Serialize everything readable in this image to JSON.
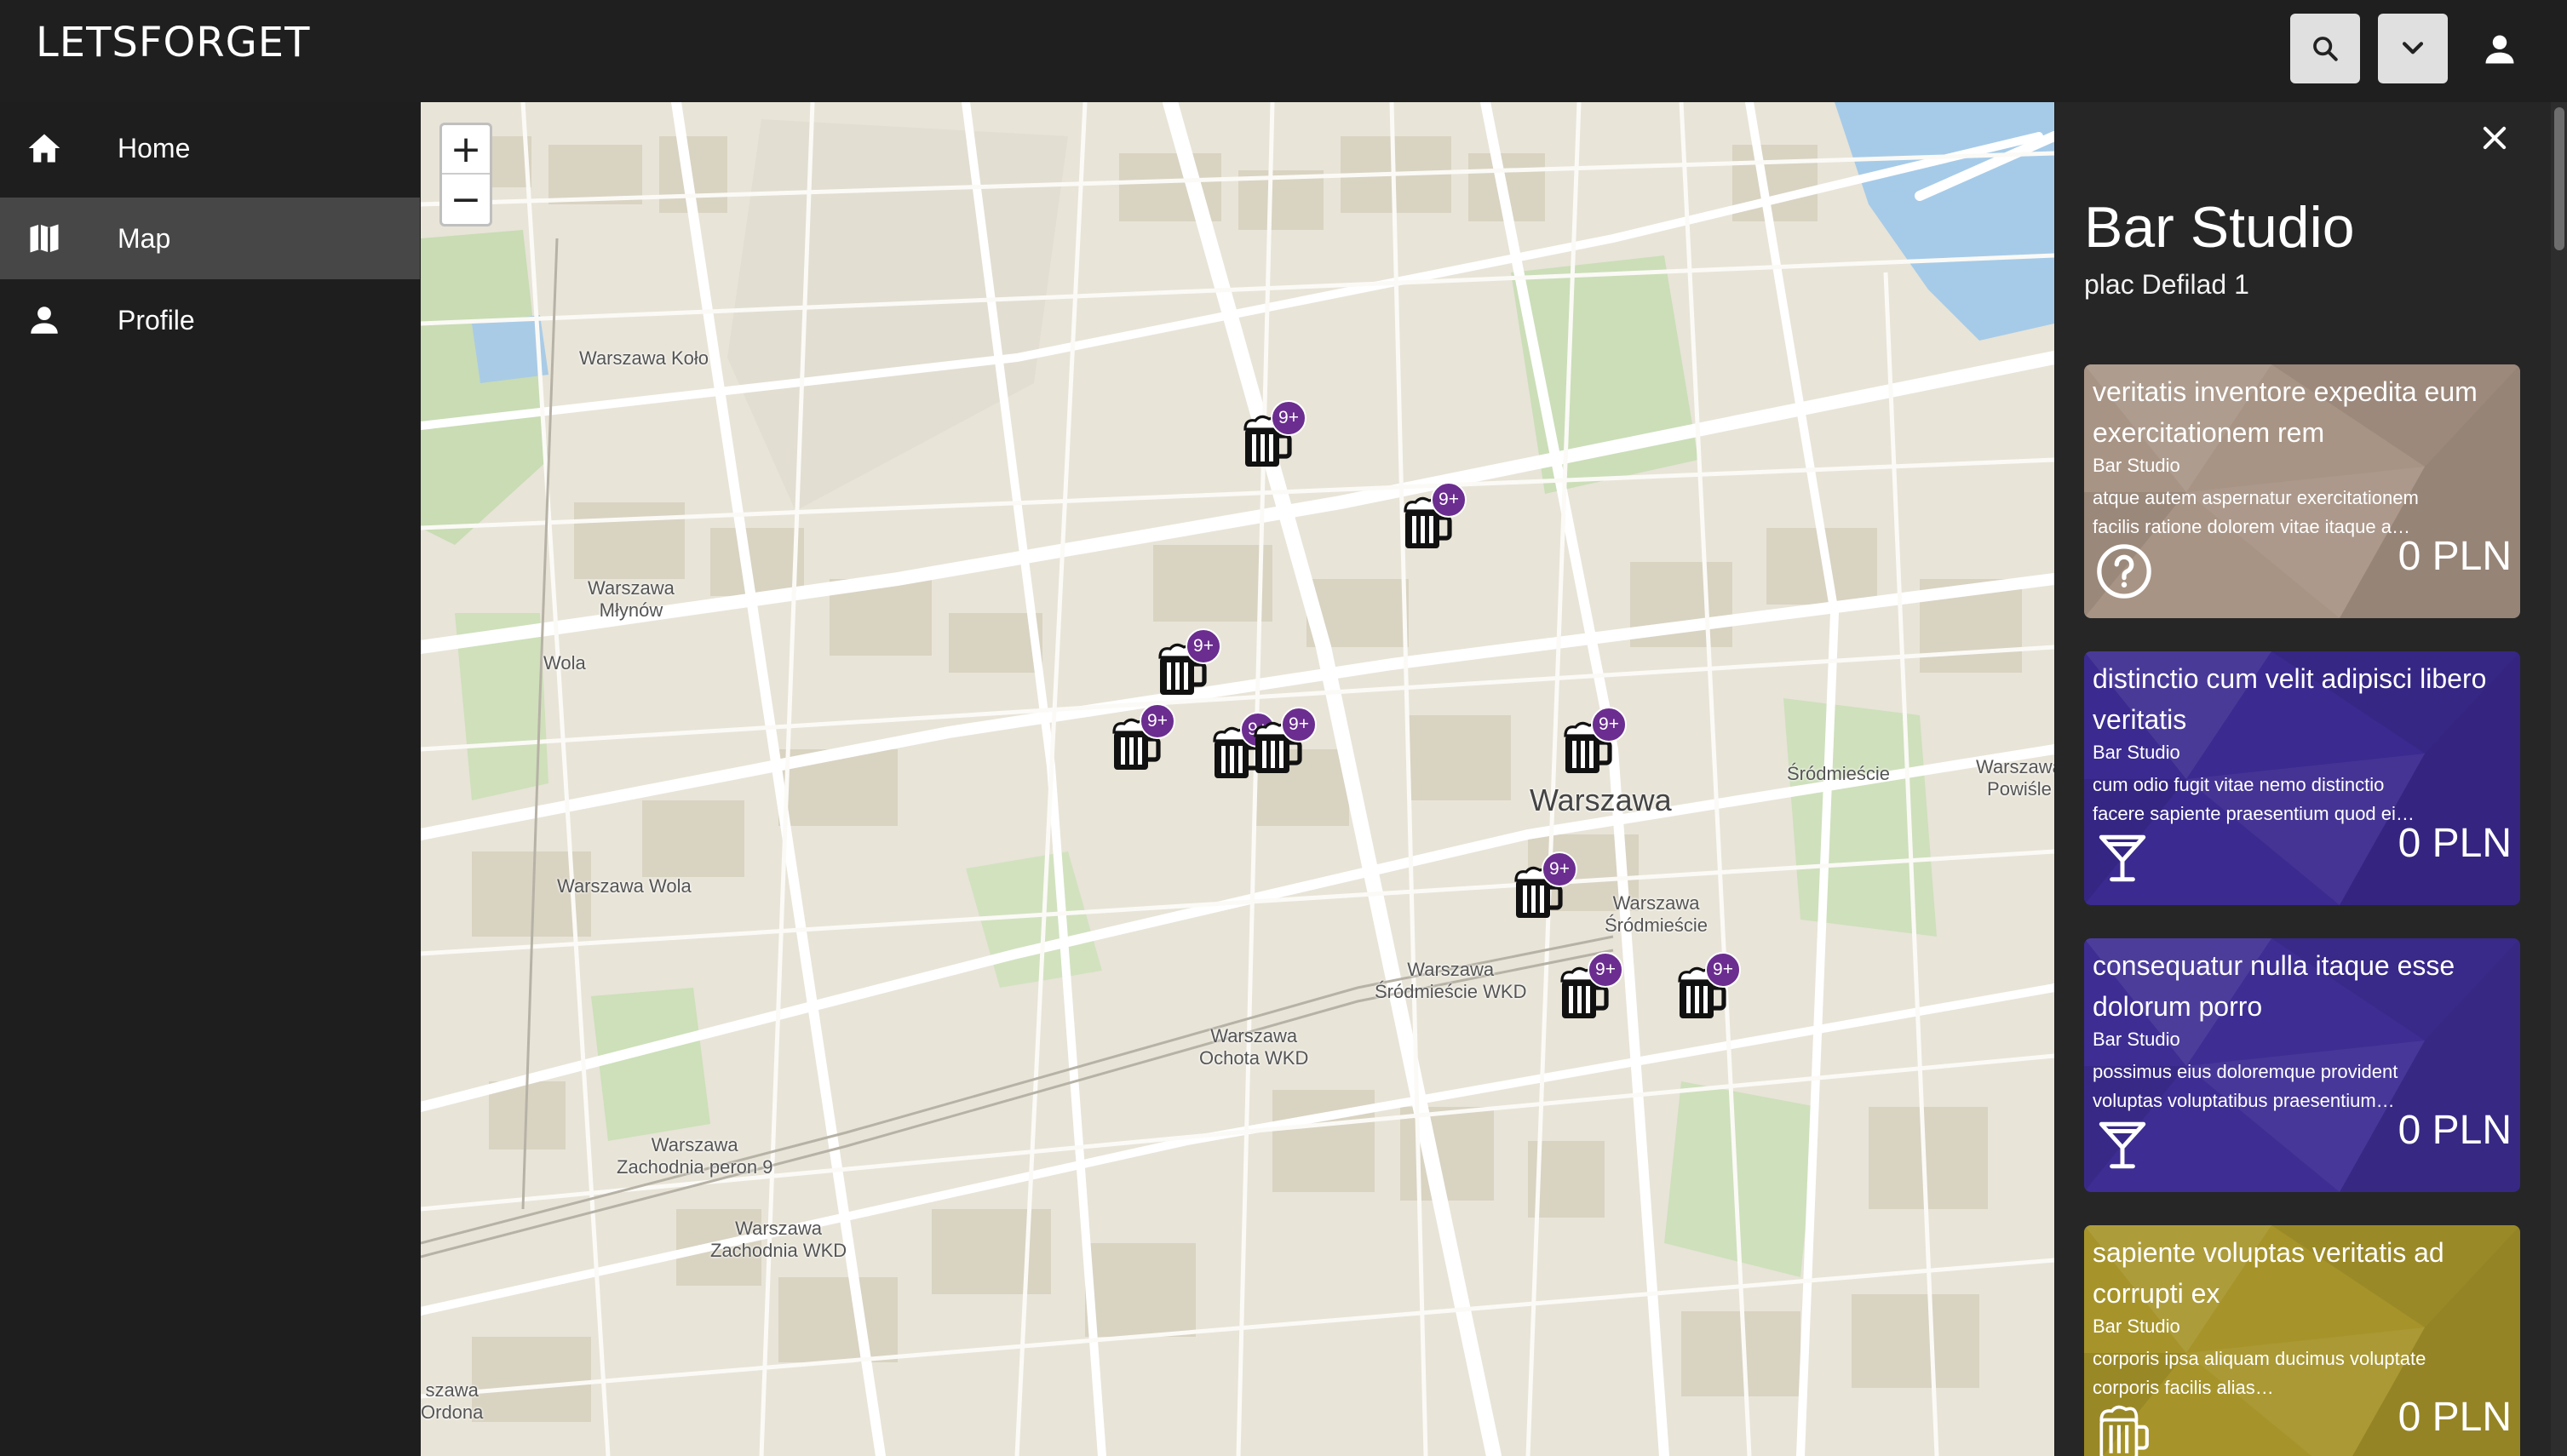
{
  "app": {
    "brand": "LETSFORGET"
  },
  "topbar": {
    "search_icon": "search-icon",
    "dropdown_icon": "chevron-down-icon",
    "account_icon": "person-icon"
  },
  "sidebar": {
    "items": [
      {
        "label": "Home",
        "icon": "home-icon",
        "active": false
      },
      {
        "label": "Map",
        "icon": "map-icon",
        "active": true
      },
      {
        "label": "Profile",
        "icon": "person-icon",
        "active": false
      }
    ]
  },
  "map": {
    "zoom_in": "+",
    "zoom_out": "−",
    "labels": [
      "Warszawa Koło",
      "Warszawa\nMłynów",
      "Wola",
      "Warszawa Wola",
      "Warszawa\nZachodnia peron 9",
      "Warszawa\nZachodnia WKD",
      "Warszawa\nOchota WKD",
      "Warszawa\nŚródmieście WKD",
      "Warszawa",
      "Śródmieście",
      "Warszawa\nPowiśle",
      "Warszawa\nŚródmieście",
      "szawa\nOrdona"
    ],
    "marker_badge": "9+",
    "marker_icon": "beer-mug-icon",
    "marker_count": 10
  },
  "panel": {
    "close_icon": "close-icon",
    "title": "Bar Studio",
    "address": "plac Defilad 1",
    "cards": [
      {
        "title": "veritatis inventore expedita eum exercitationem rem",
        "venue": "Bar Studio",
        "description": "atque autem aspernatur exercitationem facilis ratione dolorem vitae itaque a…",
        "icon": "question-circle-icon",
        "price": "0 PLN",
        "color": "#a89485"
      },
      {
        "title": "distinctio cum velit adipisci libero veritatis",
        "venue": "Bar Studio",
        "description": "cum odio fugit vitae nemo distinctio facere sapiente praesentium quod ei…",
        "icon": "cocktail-glass-icon",
        "price": "0 PLN",
        "color": "#3b2a8f"
      },
      {
        "title": "consequatur nulla itaque esse dolorum porro",
        "venue": "Bar Studio",
        "description": "possimus eius doloremque provident voluptas voluptatibus praesentium…",
        "icon": "cocktail-glass-icon",
        "price": "0 PLN",
        "color": "#3e2d93"
      },
      {
        "title": "sapiente voluptas veritatis ad corrupti ex",
        "venue": "Bar Studio",
        "description": "corporis ipsa aliquam ducimus voluptate corporis facilis alias…",
        "icon": "beer-mug-icon",
        "price": "0 PLN",
        "color": "#a6942a"
      }
    ]
  }
}
